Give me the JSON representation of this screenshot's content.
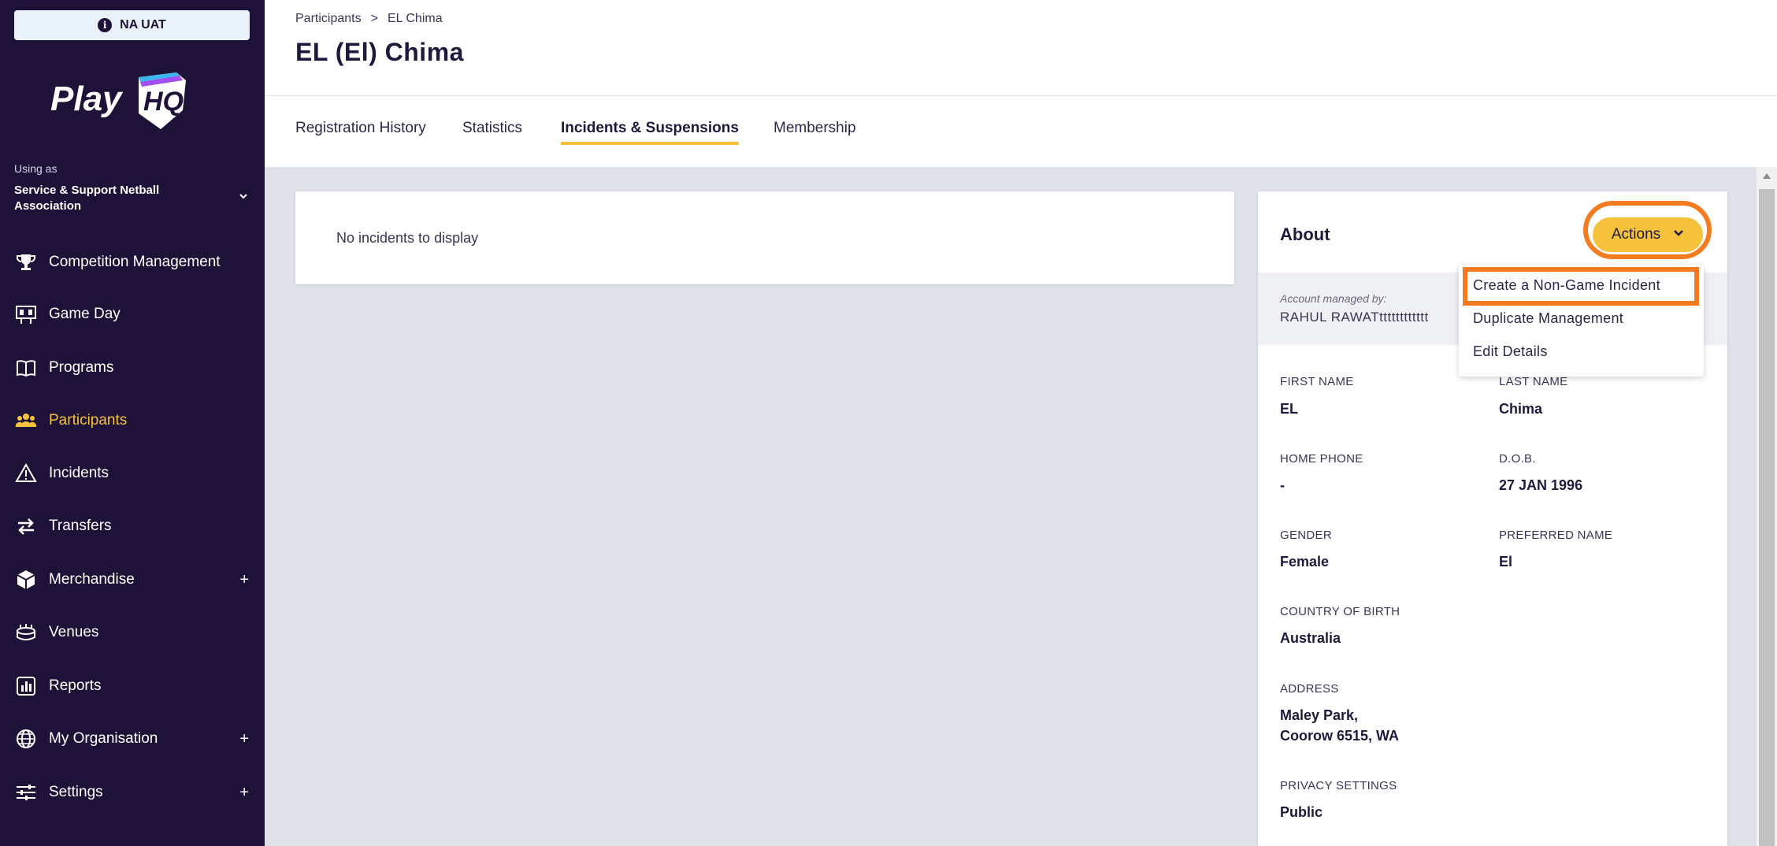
{
  "env_badge": {
    "icon": "info-icon",
    "label": "NA UAT"
  },
  "logo": {
    "text": "Play",
    "mark": "HQ"
  },
  "org": {
    "using_as": "Using as",
    "name": "Service & Support Netball Association"
  },
  "nav": [
    {
      "label": "Competition Management",
      "icon": "trophy-icon"
    },
    {
      "label": "Game Day",
      "icon": "scoreboard-icon"
    },
    {
      "label": "Programs",
      "icon": "book-icon"
    },
    {
      "label": "Participants",
      "icon": "people-icon",
      "active": true
    },
    {
      "label": "Incidents",
      "icon": "warning-icon"
    },
    {
      "label": "Transfers",
      "icon": "transfer-icon"
    },
    {
      "label": "Merchandise",
      "icon": "box-icon",
      "expandable": true
    },
    {
      "label": "Venues",
      "icon": "stadium-icon"
    },
    {
      "label": "Reports",
      "icon": "reports-icon"
    },
    {
      "label": "My Organisation",
      "icon": "globe-icon",
      "expandable": true
    },
    {
      "label": "Settings",
      "icon": "sliders-icon",
      "expandable": true
    }
  ],
  "breadcrumb": {
    "parent": "Participants",
    "separator": ">",
    "current": "EL Chima"
  },
  "page_title": "EL (El) Chima",
  "tabs": [
    {
      "label": "Registration History"
    },
    {
      "label": "Statistics"
    },
    {
      "label": "Incidents & Suspensions",
      "active": true
    },
    {
      "label": "Membership"
    }
  ],
  "empty_message": "No incidents to display",
  "about": {
    "title": "About",
    "actions_label": "Actions",
    "managed_label": "Account managed by:",
    "managed_value": "RAHUL RAWATtttttttttttt",
    "fields": {
      "first_name": {
        "label": "FIRST NAME",
        "value": "EL"
      },
      "last_name": {
        "label": "LAST NAME",
        "value": "Chima"
      },
      "home_phone": {
        "label": "HOME PHONE",
        "value": "-"
      },
      "dob": {
        "label": "D.O.B.",
        "value": "27 JAN 1996"
      },
      "gender": {
        "label": "GENDER",
        "value": "Female"
      },
      "preferred_name": {
        "label": "PREFERRED NAME",
        "value": "El"
      },
      "country": {
        "label": "COUNTRY OF BIRTH",
        "value": "Australia"
      },
      "address": {
        "label": "ADDRESS",
        "line1": "Maley Park,",
        "line2": "Coorow 6515, WA"
      },
      "privacy": {
        "label": "PRIVACY SETTINGS",
        "value": "Public"
      }
    }
  },
  "actions_menu": [
    {
      "label": "Create a Non-Game Incident"
    },
    {
      "label": "Duplicate Management"
    },
    {
      "label": "Edit Details"
    }
  ],
  "colors": {
    "sidebar_bg": "#1f1239",
    "accent": "#f6c23b",
    "highlight": "#f47b20"
  }
}
